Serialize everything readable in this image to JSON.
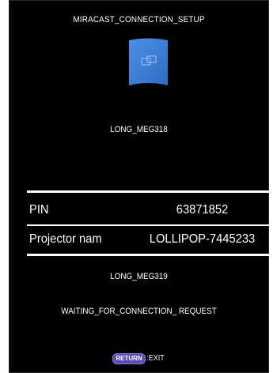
{
  "header": {
    "title": "MIRACAST_CONNECTION_SETUP"
  },
  "device": {
    "icon": "wireless-display-icon",
    "name": "LONG_MEG318",
    "accent_color": "#3f7fd8"
  },
  "info": {
    "pin_label": "PIN",
    "pin_value": "63871852",
    "projector_label": "Projector nam",
    "projector_value": "LOLLIPOP-7445233"
  },
  "peer": {
    "name": "LONG_MEG319"
  },
  "status": {
    "text": "WAITING_FOR_CONNECTION_ REQUEST"
  },
  "footer": {
    "return_key": "RETURN",
    "exit_text": ":EXIT"
  }
}
